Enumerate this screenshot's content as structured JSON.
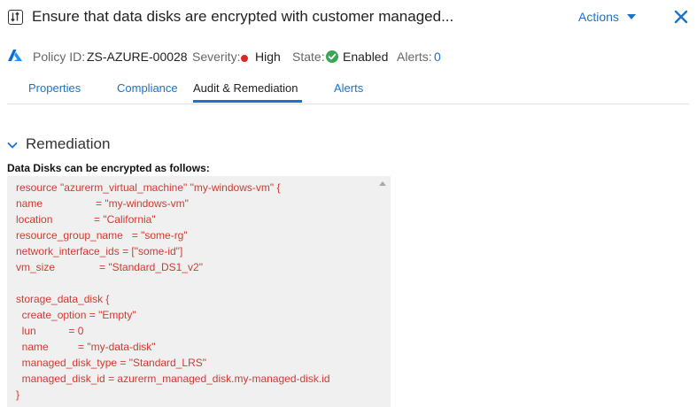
{
  "header": {
    "title": "Ensure that data disks are encrypted with customer managed...",
    "actions_label": "Actions",
    "icon": "policy-icon",
    "close_icon": "close-icon"
  },
  "meta": {
    "policy_id_label": "Policy ID:",
    "policy_id": "ZS-AZURE-00028",
    "severity_label": "Severity:",
    "severity": "High",
    "state_label": "State:",
    "state": "Enabled",
    "alerts_label": "Alerts:",
    "alerts": "0",
    "cloud_logo": "azure-logo"
  },
  "tabs": [
    {
      "label": "Properties"
    },
    {
      "label": "Compliance"
    },
    {
      "label": "Audit & Remediation"
    },
    {
      "label": "Alerts"
    }
  ],
  "active_tab": "Audit & Remediation",
  "remediation": {
    "section_title": "Remediation",
    "intro": "Data Disks can be encrypted as follows:",
    "code": [
      "resource \"azurerm_virtual_machine\" \"my-windows-vm\" {",
      "name                  = \"my-windows-vm\"",
      "location              = \"California\"",
      "resource_group_name   = \"some-rg\"",
      "network_interface_ids = [\"some-id\"]",
      "vm_size               = \"Standard_DS1_v2\"",
      "",
      "storage_data_disk {",
      "  create_option = \"Empty\"",
      "  lun           = 0",
      "  name          = \"my-data-disk\"",
      "  managed_disk_type = \"Standard_LRS\"",
      "  managed_disk_id = azurerm_managed_disk.my-managed-disk.id",
      "}"
    ]
  },
  "colors": {
    "accent": "#1a73c8",
    "severity_high": "#e02424",
    "state_enabled": "#3aa655",
    "code_text": "#d23a30",
    "code_bg": "#f0f0f0"
  }
}
